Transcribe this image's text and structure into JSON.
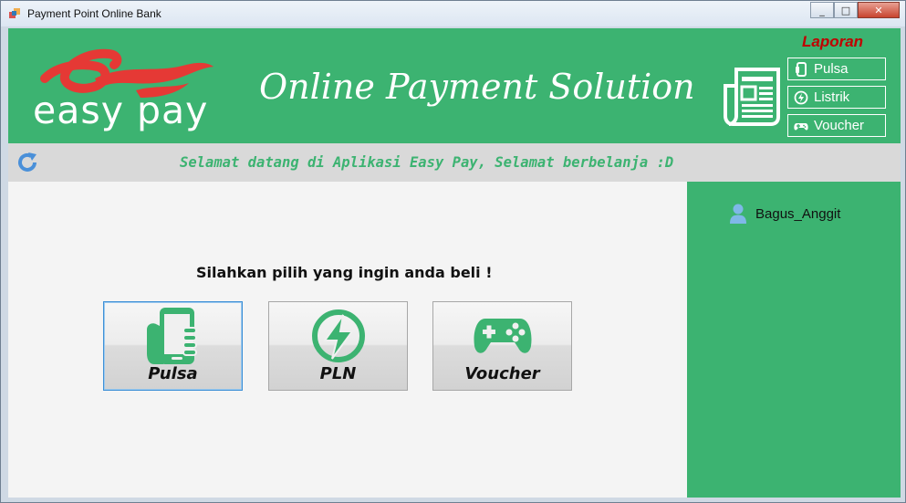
{
  "window": {
    "title": "Payment Point Online Bank",
    "min": "_",
    "max": "□",
    "close": "✕"
  },
  "header": {
    "logo_text": "easy pay",
    "slogan": "Online Payment Solution",
    "report_title": "Laporan",
    "report_buttons": [
      {
        "label": "Pulsa",
        "icon": "phone-icon"
      },
      {
        "label": "Listrik",
        "icon": "lightning-icon"
      },
      {
        "label": "Voucher",
        "icon": "gamepad-icon"
      }
    ]
  },
  "banner": {
    "message": "Selamat datang di Aplikasi Easy Pay, Selamat berbelanja :D"
  },
  "user": {
    "name": "Bagus_Anggit"
  },
  "main": {
    "prompt": "Silahkan pilih yang ingin anda beli !",
    "products": [
      {
        "label": "Pulsa",
        "icon": "hand-phone-icon",
        "selected": true
      },
      {
        "label": "PLN",
        "icon": "lightning-icon"
      },
      {
        "label": "Voucher",
        "icon": "gamepad-icon"
      }
    ]
  },
  "colors": {
    "brand_green": "#3cb371",
    "logo_red": "#e53935",
    "report_red": "#c00000"
  }
}
